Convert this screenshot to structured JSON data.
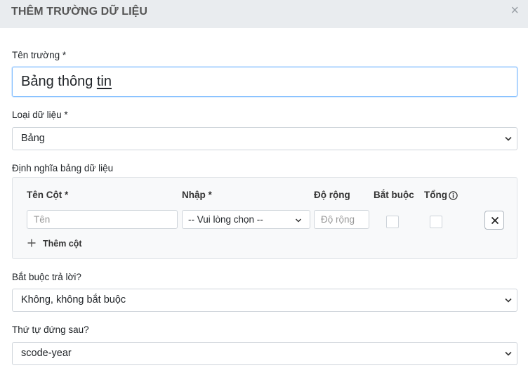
{
  "dialog": {
    "title": "THÊM TRƯỜNG DỮ LIỆU",
    "close_glyph": "×"
  },
  "field_name": {
    "label": "Tên trường *",
    "value_part1": "Bảng thông ",
    "value_part2": "tin"
  },
  "data_type": {
    "label": "Loại dữ liệu *",
    "value": "Bảng"
  },
  "table_definition": {
    "label": "Định nghĩa bảng dữ liệu",
    "headers": {
      "column_name": "Tên Cột *",
      "input_type": "Nhập *",
      "width": "Độ rộng",
      "required": "Bắt buộc",
      "total": "Tổng"
    },
    "row": {
      "name_placeholder": "Tên",
      "input_type_value": "-- Vui lòng chọn --",
      "width_placeholder": "Độ rộng",
      "required_checked": false,
      "total_checked": false
    },
    "add_column_label": "Thêm cột"
  },
  "required_answer": {
    "label": "Bắt buộc trả lời?",
    "value": "Không, không bắt buộc"
  },
  "order_after": {
    "label": "Thứ tự đứng sau?",
    "value": "scode-year"
  },
  "icons": {
    "close": "close-icon",
    "chevron": "chevron-down-icon",
    "info": "info-icon",
    "remove": "x-icon",
    "add": "plus-icon"
  },
  "colors": {
    "header_bg": "#e9ecef",
    "focus_border": "#80bdff",
    "panel_bg": "#f8f9fa"
  }
}
